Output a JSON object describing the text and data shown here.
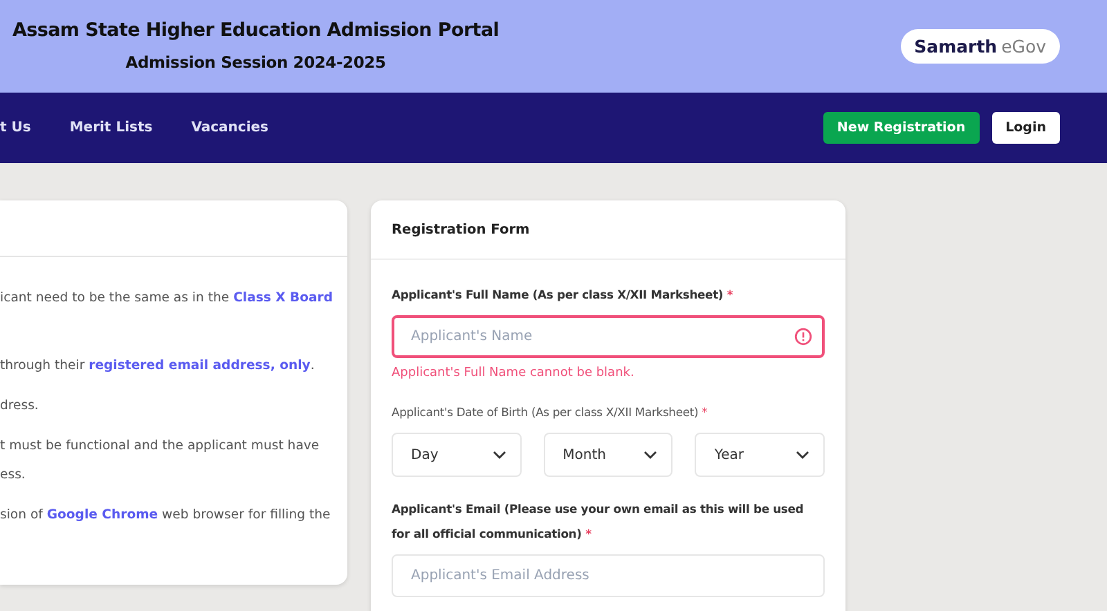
{
  "header": {
    "title": "Assam State Higher Education Admission Portal",
    "subtitle": "Admission Session 2024-2025",
    "logo": {
      "primary": "Samarth",
      "secondary": "eGov"
    }
  },
  "nav": {
    "links": [
      "t Us",
      "Merit Lists",
      "Vacancies"
    ],
    "buttons": [
      {
        "label": "New Registration",
        "kind": "primary"
      },
      {
        "label": "Login",
        "kind": "plain"
      }
    ]
  },
  "instructions": {
    "paragraphs": [
      {
        "lines": [
          "icant need to be the same as in the **Class X Board**"
        ]
      },
      {
        "lines": [
          "through their **registered email address, only**."
        ]
      },
      {
        "lines": [
          "dress."
        ]
      },
      {
        "lines": [
          "t must be functional and the applicant must have",
          "ess."
        ]
      },
      {
        "lines": [
          "sion of **Google Chrome** web browser for filling the"
        ]
      }
    ]
  },
  "form": {
    "title": "Registration Form",
    "fields": [
      {
        "kind": "text",
        "label": "Applicant's Full Name (As per class X/XII Marksheet)",
        "required_mark": "*",
        "placeholder": "Applicant's Name",
        "invalid": true,
        "error": "Applicant's Full Name cannot be blank."
      },
      {
        "kind": "date",
        "label": "Applicant's Date of Birth (As per class X/XII Marksheet)",
        "required_mark": "*",
        "selects": [
          "Day",
          "Month",
          "Year"
        ]
      },
      {
        "kind": "text",
        "label": "Applicant's Email (Please use your own email as this will be used for all official communication)",
        "required_mark": "*",
        "placeholder": "Applicant's Email Address",
        "invalid": false
      }
    ]
  }
}
